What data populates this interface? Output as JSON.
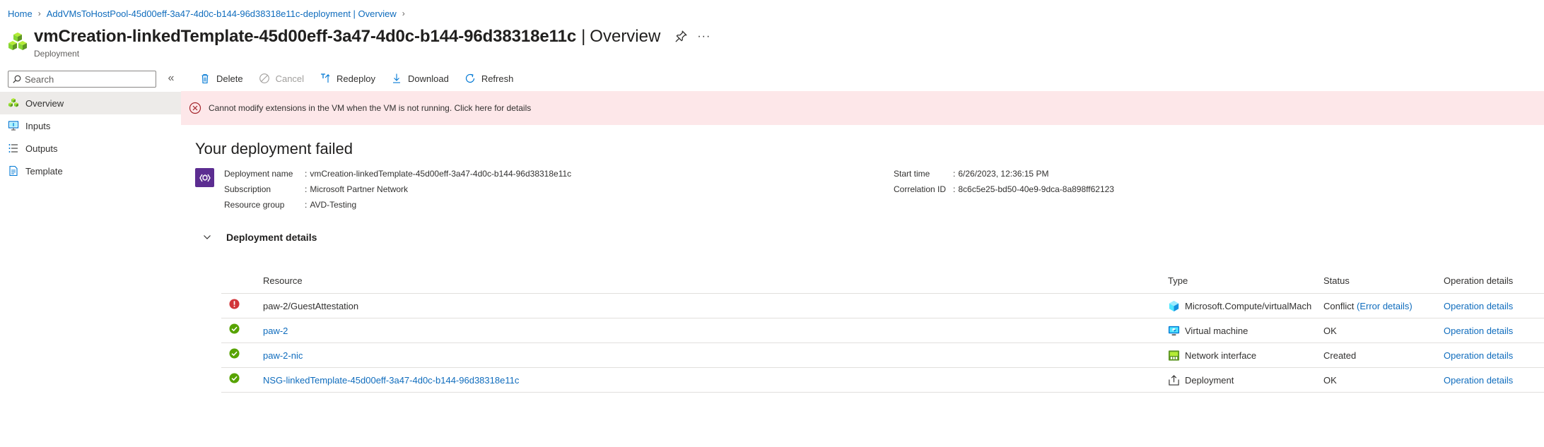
{
  "breadcrumb": {
    "items": [
      "Home",
      "AddVMsToHostPool-45d00eff-3a47-4d0c-b144-96d38318e11c-deployment | Overview"
    ]
  },
  "header": {
    "title": "vmCreation-linkedTemplate-45d00eff-3a47-4d0c-b144-96d38318e11c",
    "separator": "|",
    "subtitle": "Overview",
    "resource_type": "Deployment",
    "more": "···"
  },
  "sidebar": {
    "search_placeholder": "Search",
    "collapse": "«",
    "items": [
      {
        "label": "Overview",
        "icon": "overview-icon",
        "active": true
      },
      {
        "label": "Inputs",
        "icon": "inputs-icon",
        "active": false
      },
      {
        "label": "Outputs",
        "icon": "outputs-icon",
        "active": false
      },
      {
        "label": "Template",
        "icon": "template-icon",
        "active": false
      }
    ]
  },
  "toolbar": {
    "delete": "Delete",
    "cancel": "Cancel",
    "redeploy": "Redeploy",
    "download": "Download",
    "refresh": "Refresh"
  },
  "banner": {
    "message": "Cannot modify extensions in the VM when the VM is not running. Click here for details"
  },
  "summary": {
    "heading": "Your deployment failed",
    "deployment_name_label": "Deployment name",
    "deployment_name": "vmCreation-linkedTemplate-45d00eff-3a47-4d0c-b144-96d38318e11c",
    "subscription_label": "Subscription",
    "subscription": "Microsoft Partner Network",
    "resource_group_label": "Resource group",
    "resource_group": "AVD-Testing",
    "start_time_label": "Start time",
    "start_time": "6/26/2023, 12:36:15 PM",
    "correlation_id_label": "Correlation ID",
    "correlation_id": "8c6c5e25-bd50-40e9-9dca-8a898ff62123"
  },
  "details": {
    "title": "Deployment details",
    "columns": {
      "resource": "Resource",
      "type": "Type",
      "status": "Status",
      "operation": "Operation details"
    },
    "rows": [
      {
        "state": "error",
        "resource": "paw-2/GuestAttestation",
        "resource_link": false,
        "type": "Microsoft.Compute/virtualMach",
        "type_icon": "vm-extension-icon",
        "status": "Conflict",
        "status_link": "(Error details)",
        "operation": "Operation details"
      },
      {
        "state": "ok",
        "resource": "paw-2",
        "resource_link": true,
        "type": "Virtual machine",
        "type_icon": "virtual-machine-icon",
        "status": "OK",
        "status_link": "",
        "operation": "Operation details"
      },
      {
        "state": "ok",
        "resource": "paw-2-nic",
        "resource_link": true,
        "type": "Network interface",
        "type_icon": "network-interface-icon",
        "status": "Created",
        "status_link": "",
        "operation": "Operation details"
      },
      {
        "state": "ok",
        "resource": "NSG-linkedTemplate-45d00eff-3a47-4d0c-b144-96d38318e11c",
        "resource_link": true,
        "type": "Deployment",
        "type_icon": "deployment-icon",
        "status": "OK",
        "status_link": "",
        "operation": "Operation details"
      }
    ]
  },
  "colors": {
    "link": "#0f6cbd",
    "error": "#d13438",
    "success": "#57a300",
    "banner_bg": "#fde7e9",
    "deploy_icon_bg": "#5c2d91"
  }
}
